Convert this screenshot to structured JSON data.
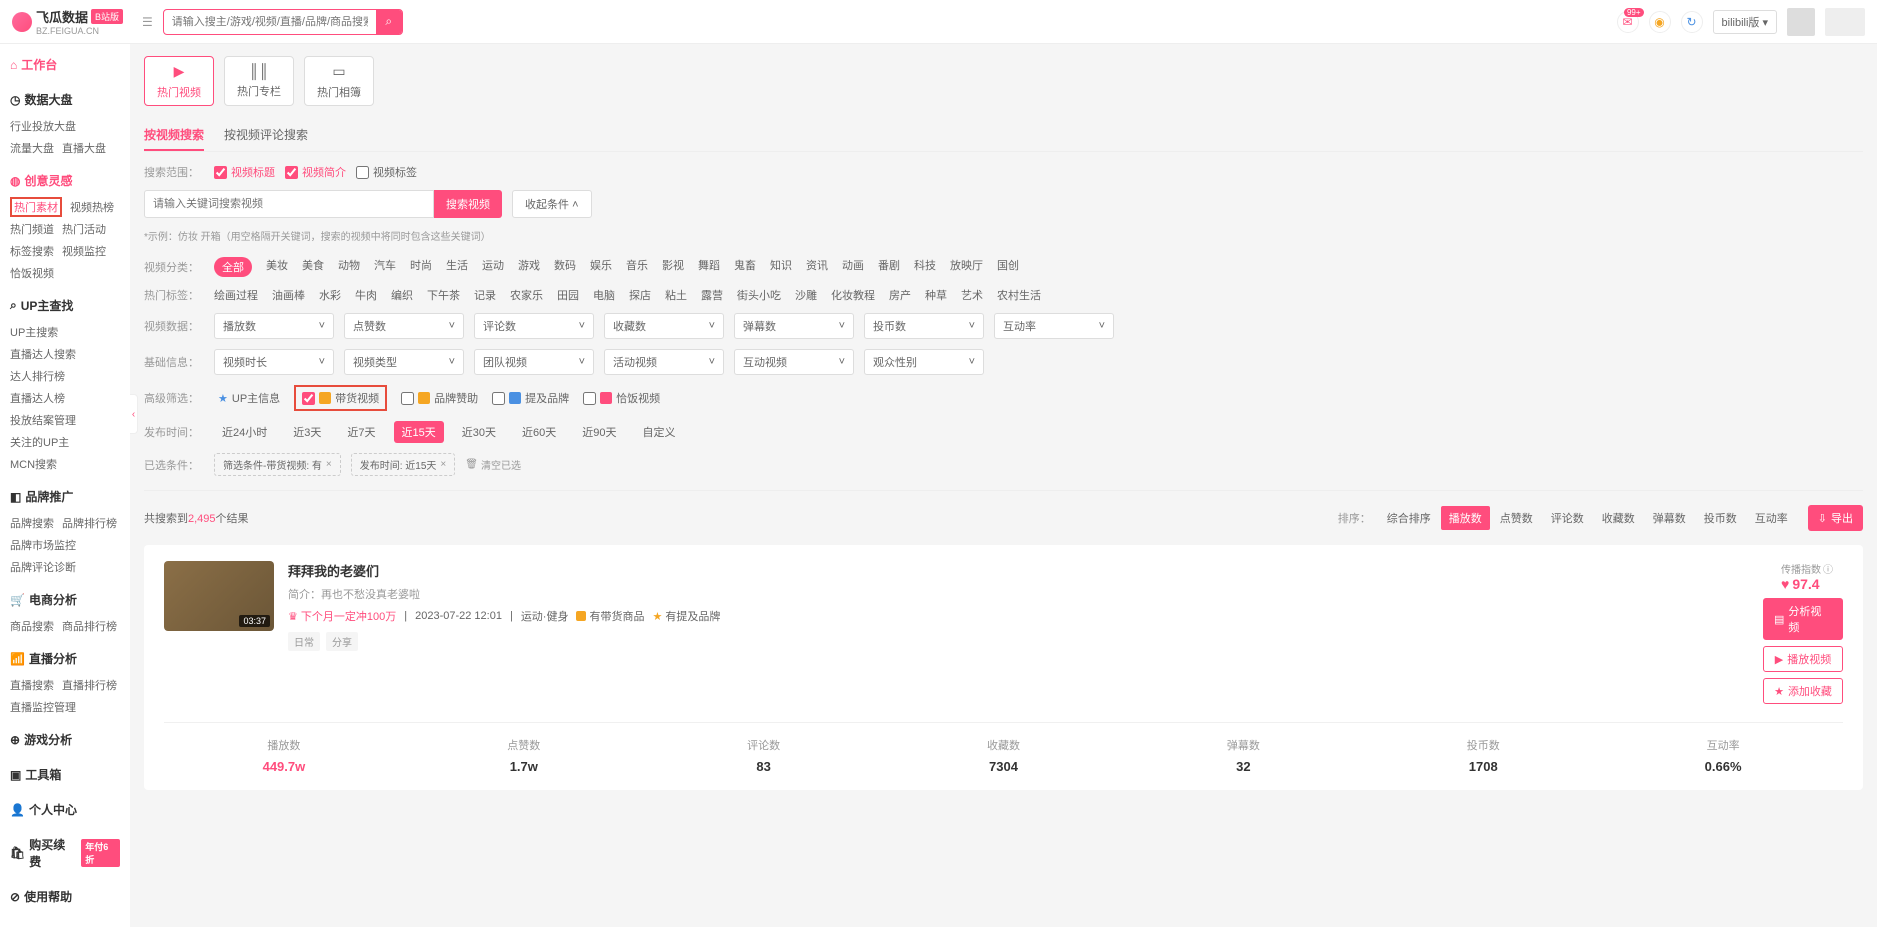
{
  "header": {
    "brand": "飞瓜数据",
    "brand_sub": "BZ.FEIGUA.CN",
    "brand_badge": "B站版",
    "search_placeholder": "请输入搜主/游戏/视频/直播/品牌/商品搜索",
    "notif_badge": "99+",
    "version": "bilibili版"
  },
  "sidebar": {
    "g0": {
      "title": "工作台"
    },
    "g1": {
      "title": "数据大盘",
      "i0": "行业投放大盘",
      "i1": "流量大盘",
      "i2": "直播大盘"
    },
    "g2": {
      "title": "创意灵感",
      "i0": "热门素材",
      "i1": "视频热榜",
      "i2": "热门频道",
      "i3": "热门活动",
      "i4": "标签搜索",
      "i5": "视频监控",
      "i6": "恰饭视频"
    },
    "g3": {
      "title": "UP主查找",
      "i0": "UP主搜索",
      "i1": "直播达人搜索",
      "i2": "达人排行榜",
      "i3": "直播达人榜",
      "i4": "投放结案管理",
      "i5": "关注的UP主",
      "i6": "MCN搜索"
    },
    "g4": {
      "title": "品牌推广",
      "i0": "品牌搜索",
      "i1": "品牌排行榜",
      "i2": "品牌市场监控",
      "i3": "品牌评论诊断"
    },
    "g5": {
      "title": "电商分析",
      "i0": "商品搜索",
      "i1": "商品排行榜"
    },
    "g6": {
      "title": "直播分析",
      "i0": "直播搜索",
      "i1": "直播排行榜",
      "i2": "直播监控管理"
    },
    "g7": {
      "title": "游戏分析"
    },
    "g8": {
      "title": "工具箱"
    },
    "g9": {
      "title": "个人中心"
    },
    "g10": {
      "title": "购买续费",
      "badge": "年付6折"
    },
    "g11": {
      "title": "使用帮助"
    }
  },
  "tabs": {
    "t1": "热门视频",
    "t2": "热门专栏",
    "t3": "热门相簿"
  },
  "subtabs": {
    "s1": "按视频搜索",
    "s2": "按视频评论搜索"
  },
  "scope": {
    "label": "搜索范围：",
    "o1": "视频标题",
    "o2": "视频简介",
    "o3": "视频标签"
  },
  "kw": {
    "placeholder": "请输入关键词搜索视频",
    "btn": "搜索视频",
    "collapse": "收起条件",
    "hint": "*示例：仿妆 开箱（用空格隔开关键词，搜索的视频中将同时包含这些关键词）"
  },
  "cat": {
    "label": "视频分类：",
    "all": "全部",
    "c1": "美妆",
    "c2": "美食",
    "c3": "动物",
    "c4": "汽车",
    "c5": "时尚",
    "c6": "生活",
    "c7": "运动",
    "c8": "游戏",
    "c9": "数码",
    "c10": "娱乐",
    "c11": "音乐",
    "c12": "影视",
    "c13": "舞蹈",
    "c14": "鬼畜",
    "c15": "知识",
    "c16": "资讯",
    "c17": "动画",
    "c18": "番剧",
    "c19": "科技",
    "c20": "放映厅",
    "c21": "国创"
  },
  "hottag": {
    "label": "热门标签：",
    "t1": "绘画过程",
    "t2": "油画棒",
    "t3": "水彩",
    "t4": "牛肉",
    "t5": "编织",
    "t6": "下午茶",
    "t7": "记录",
    "t8": "农家乐",
    "t9": "田园",
    "t10": "电脑",
    "t11": "探店",
    "t12": "粘土",
    "t13": "露营",
    "t14": "街头小吃",
    "t15": "沙雕",
    "t16": "化妆教程",
    "t17": "房产",
    "t18": "种草",
    "t19": "艺术",
    "t20": "农村生活"
  },
  "metrics": {
    "label": "视频数据：",
    "m1": "播放数",
    "m2": "点赞数",
    "m3": "评论数",
    "m4": "收藏数",
    "m5": "弹幕数",
    "m6": "投币数",
    "m7": "互动率"
  },
  "basic": {
    "label": "基础信息：",
    "b1": "视频时长",
    "b2": "视频类型",
    "b3": "团队视频",
    "b4": "活动视频",
    "b5": "互动视频",
    "b6": "观众性别"
  },
  "adv": {
    "label": "高级筛选：",
    "a1": "UP主信息",
    "a2": "带货视频",
    "a3": "品牌赞助",
    "a4": "提及品牌",
    "a5": "恰饭视频"
  },
  "time": {
    "label": "发布时间：",
    "t1": "近24小时",
    "t2": "近3天",
    "t3": "近7天",
    "t4": "近15天",
    "t5": "近30天",
    "t6": "近60天",
    "t7": "近90天",
    "t8": "自定义"
  },
  "chips": {
    "label": "已选条件：",
    "c1": "筛选条件-带货视频: 有",
    "c2": "发布时间: 近15天",
    "clear": "清空已选"
  },
  "results": {
    "prefix": "共搜索到",
    "count": "2,495",
    "suffix": "个结果"
  },
  "sort": {
    "label": "排序：",
    "s0": "综合排序",
    "s1": "播放数",
    "s2": "点赞数",
    "s3": "评论数",
    "s4": "收藏数",
    "s5": "弹幕数",
    "s6": "投币数",
    "s7": "互动率",
    "export": "导出"
  },
  "video": {
    "duration": "03:37",
    "title": "拜拜我的老婆们",
    "desc_label": "简介：",
    "desc": "再也不愁没真老婆啦",
    "author": "下个月一定冲100万",
    "date": "2023-07-22 12:01",
    "category": "运动·健身",
    "goods": "有带货商品",
    "brand": "有提及品牌",
    "tag1": "日常",
    "tag2": "分享",
    "spread_label": "传播指数",
    "spread_val": "97.4",
    "btn1": "分析视频",
    "btn2": "播放视频",
    "btn3": "添加收藏",
    "stats": {
      "l1": "播放数",
      "v1": "449.7w",
      "l2": "点赞数",
      "v2": "1.7w",
      "l3": "评论数",
      "v3": "83",
      "l4": "收藏数",
      "v4": "7304",
      "l5": "弹幕数",
      "v5": "32",
      "l6": "投币数",
      "v6": "1708",
      "l7": "互动率",
      "v7": "0.66%"
    }
  }
}
